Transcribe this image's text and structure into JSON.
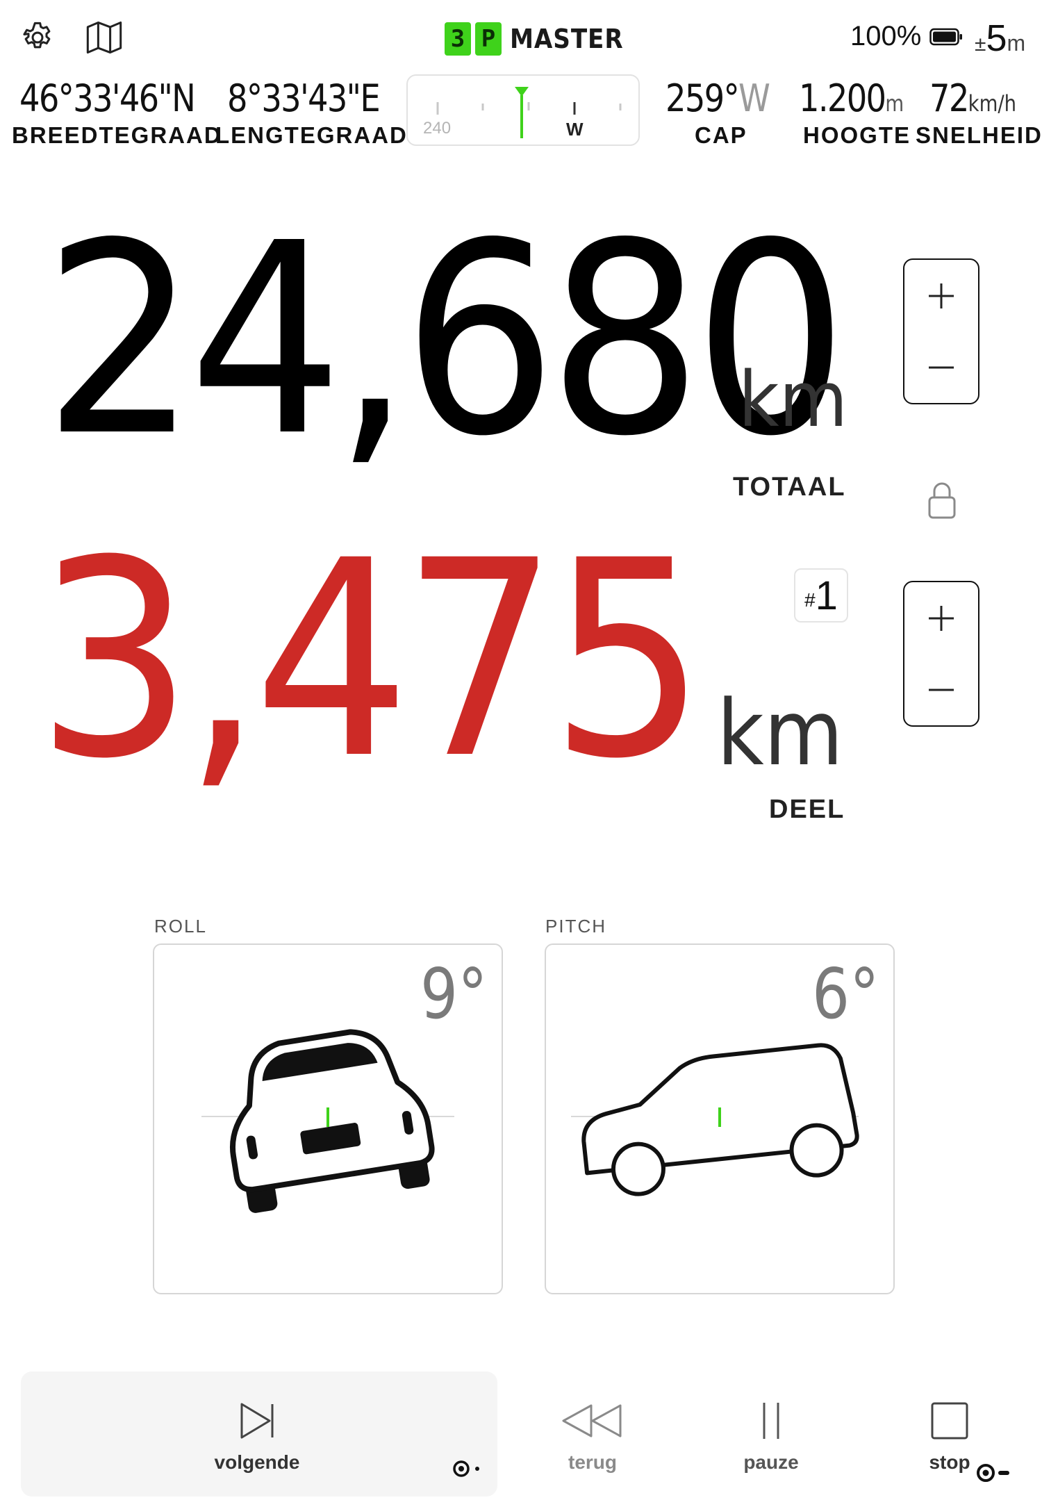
{
  "header": {
    "logo": {
      "box1": "3",
      "box2": "P",
      "word": "MASTER"
    },
    "battery": "100%",
    "accuracy": {
      "prefix": "±",
      "value": "5",
      "unit": "m"
    }
  },
  "navigation": {
    "latitude": {
      "value": "46°33'46\"N",
      "label": "BREEDTEGRAAD"
    },
    "longitude": {
      "value": "8°33'43\"E",
      "label": "LENGTEGRAAD"
    },
    "compass": {
      "tick_label": "240",
      "cardinal": "W"
    },
    "heading": {
      "value": "259°",
      "dir": "W",
      "label": "CAP"
    },
    "altitude": {
      "value": "1.200",
      "unit": "m",
      "label": "HOOGTE"
    },
    "speed": {
      "value": "72",
      "unit": "km/h",
      "label": "SNELHEID"
    }
  },
  "odometer": {
    "total": {
      "value": "24,680",
      "unit": "km",
      "label": "TOTAAL"
    },
    "partial": {
      "value": "3,475",
      "unit": "km",
      "label": "DEEL",
      "badge_hash": "#",
      "badge_num": "1"
    }
  },
  "inclinometer": {
    "roll": {
      "label": "ROLL",
      "value": "9°"
    },
    "pitch": {
      "label": "PITCH",
      "value": "6°"
    }
  },
  "controls": {
    "next": "volgende",
    "back": "terug",
    "pause": "pauze",
    "stop": "stop"
  },
  "colors": {
    "accent_green": "#3fd21b",
    "partial_red": "#cd2a26"
  }
}
